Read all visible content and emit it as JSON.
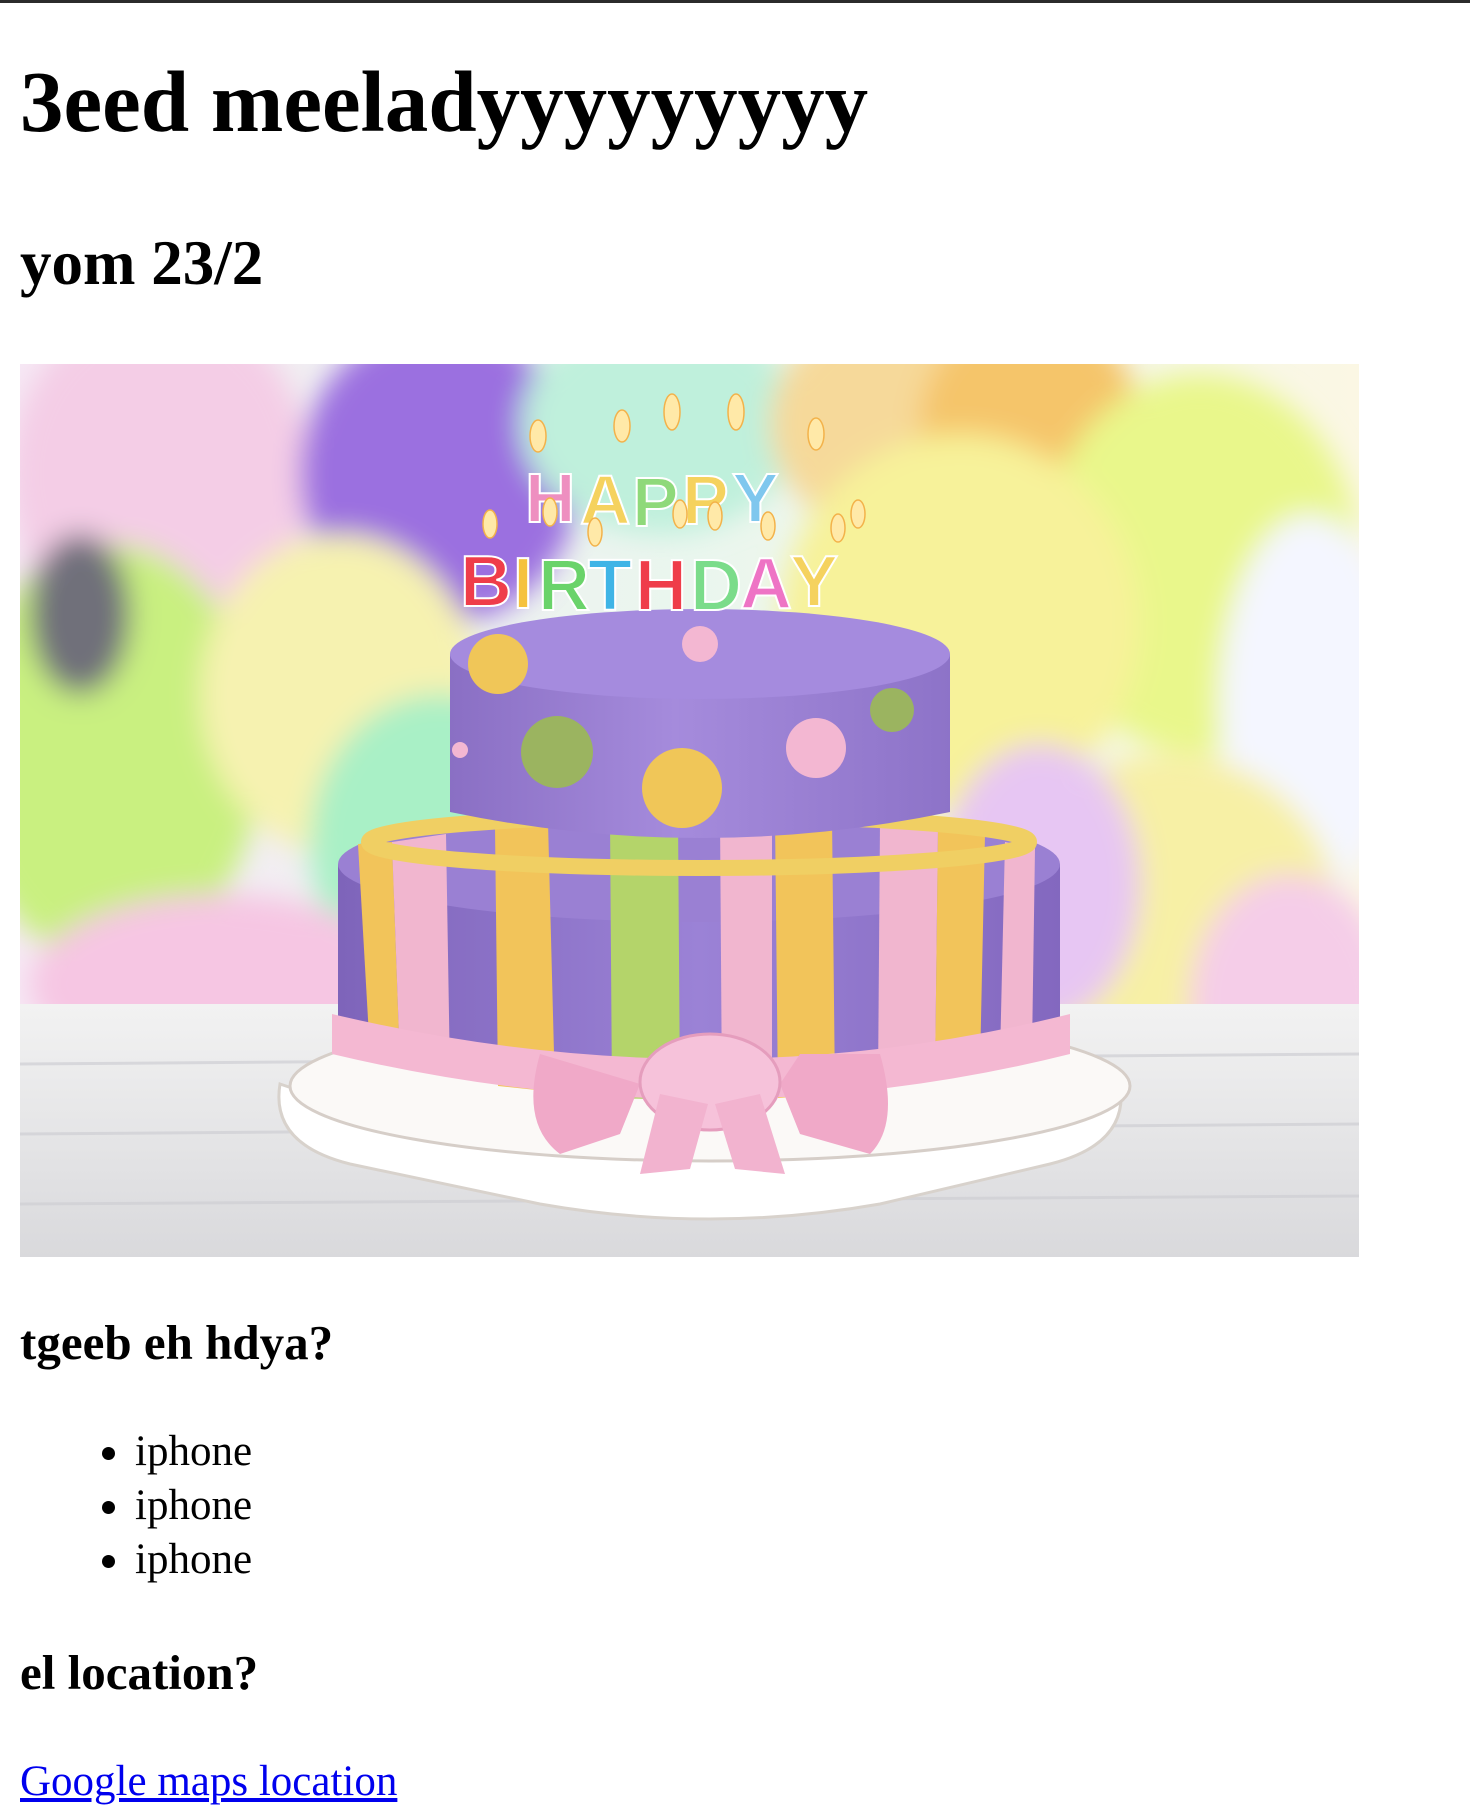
{
  "page": {
    "title": "3eed meeladyyyyyyyyy",
    "date": "yom 23/2",
    "image_alt": "birthday cake",
    "cake_text": [
      "HAPPY",
      "BIRTHDAY"
    ],
    "gift_heading": "tgeeb eh hdya?",
    "gifts": [
      "iphone",
      "iphone",
      "iphone"
    ],
    "location_heading": "el location?",
    "location_link": "Google maps location"
  },
  "colors": {
    "link": "#0000ee",
    "text": "#000000",
    "cake_purple": "#9a7fd1",
    "ribbon_pink": "#f1b6cf",
    "stripe_yellow": "#f2c45a",
    "stripe_green": "#b4d46a"
  }
}
